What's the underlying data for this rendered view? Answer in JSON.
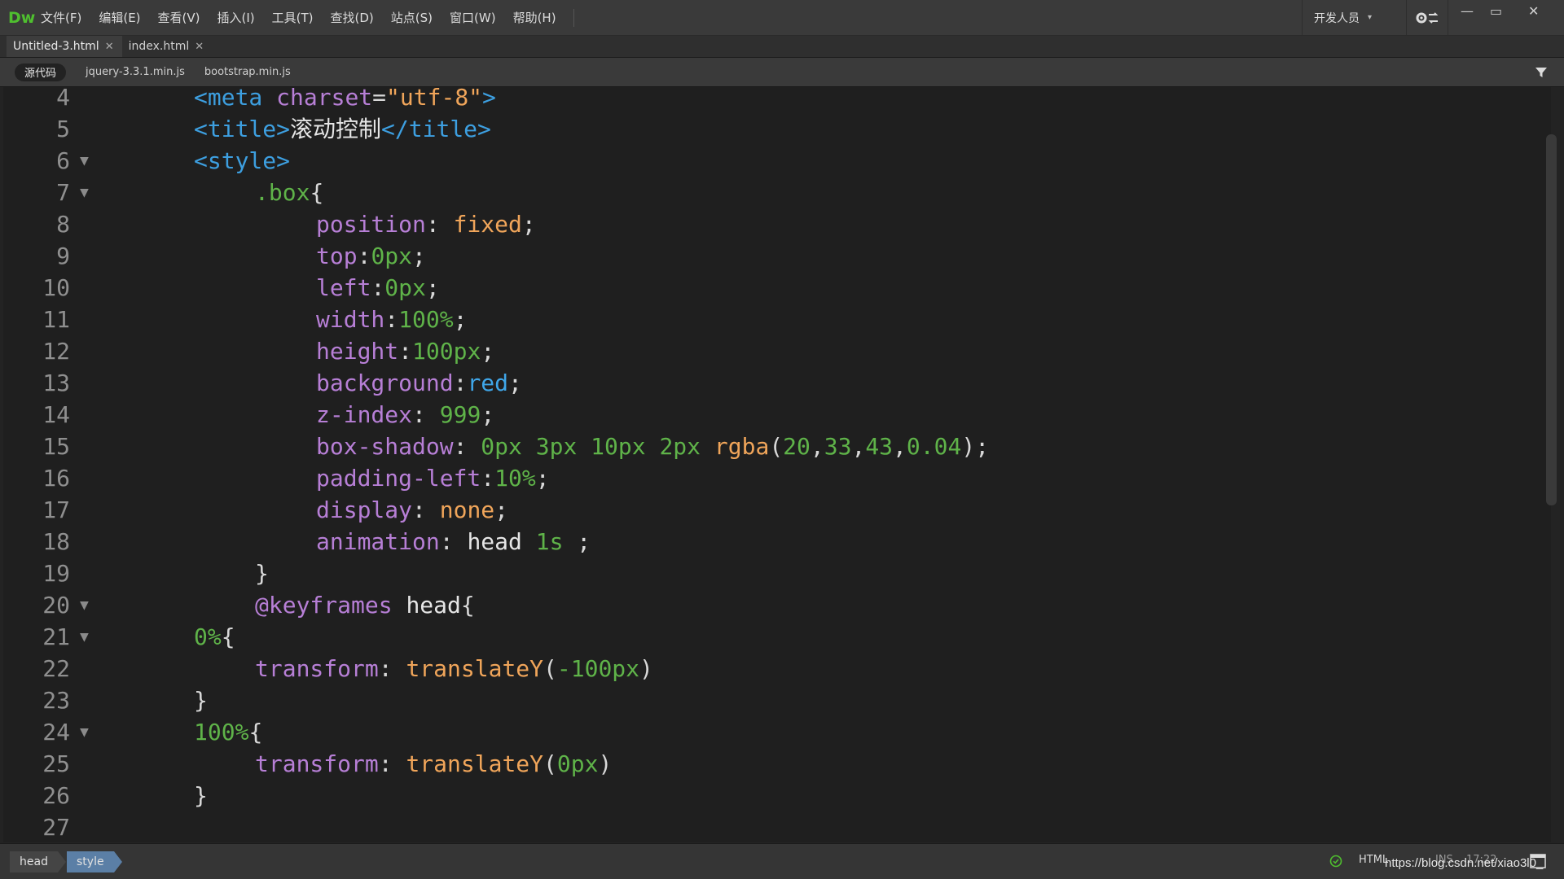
{
  "app": {
    "logo": "Dw"
  },
  "menu": [
    "文件(F)",
    "编辑(E)",
    "查看(V)",
    "插入(I)",
    "工具(T)",
    "查找(D)",
    "站点(S)",
    "窗口(W)",
    "帮助(H)"
  ],
  "workspace": {
    "label": "开发人员"
  },
  "window_controls": {
    "minimize": "—",
    "maximize": "▭",
    "close": "✕"
  },
  "doc_tabs": [
    {
      "label": "Untitled-3.html",
      "active": true
    },
    {
      "label": "index.html",
      "active": false
    }
  ],
  "related_files": {
    "source": "源代码",
    "files": [
      "jquery-3.3.1.min.js",
      "bootstrap.min.js"
    ]
  },
  "code_lines": [
    {
      "n": "4",
      "fold": false,
      "indent": 4,
      "tokens": [
        [
          "tag",
          "<meta "
        ],
        [
          "attr",
          "charset"
        ],
        [
          "pun",
          "="
        ],
        [
          "str",
          "\"utf-8\""
        ],
        [
          "tag",
          ">"
        ]
      ]
    },
    {
      "n": "5",
      "fold": false,
      "indent": 4,
      "tokens": [
        [
          "tag",
          "<title>"
        ],
        [
          "txt",
          "滚动控制"
        ],
        [
          "tag",
          "</title>"
        ]
      ]
    },
    {
      "n": "6",
      "fold": true,
      "indent": 4,
      "tokens": [
        [
          "tag",
          "<style>"
        ]
      ]
    },
    {
      "n": "7",
      "fold": true,
      "indent": 8,
      "tokens": [
        [
          "cls",
          ".box"
        ],
        [
          "pun",
          "{"
        ]
      ]
    },
    {
      "n": "8",
      "fold": false,
      "indent": 12,
      "tokens": [
        [
          "prop",
          "position"
        ],
        [
          "pun",
          ": "
        ],
        [
          "kw",
          "fixed"
        ],
        [
          "pun",
          ";"
        ]
      ]
    },
    {
      "n": "9",
      "fold": false,
      "indent": 12,
      "tokens": [
        [
          "prop",
          "top"
        ],
        [
          "pun",
          ":"
        ],
        [
          "num",
          "0px"
        ],
        [
          "pun",
          ";"
        ]
      ]
    },
    {
      "n": "10",
      "fold": false,
      "indent": 12,
      "tokens": [
        [
          "prop",
          "left"
        ],
        [
          "pun",
          ":"
        ],
        [
          "num",
          "0px"
        ],
        [
          "pun",
          ";"
        ]
      ]
    },
    {
      "n": "11",
      "fold": false,
      "indent": 12,
      "tokens": [
        [
          "prop",
          "width"
        ],
        [
          "pun",
          ":"
        ],
        [
          "num",
          "100%"
        ],
        [
          "pun",
          ";"
        ]
      ]
    },
    {
      "n": "12",
      "fold": false,
      "indent": 12,
      "tokens": [
        [
          "prop",
          "height"
        ],
        [
          "pun",
          ":"
        ],
        [
          "num",
          "100px"
        ],
        [
          "pun",
          ";"
        ]
      ]
    },
    {
      "n": "13",
      "fold": false,
      "indent": 12,
      "tokens": [
        [
          "prop",
          "background"
        ],
        [
          "pun",
          ":"
        ],
        [
          "col",
          "red"
        ],
        [
          "pun",
          ";"
        ]
      ]
    },
    {
      "n": "14",
      "fold": false,
      "indent": 12,
      "tokens": [
        [
          "prop",
          "z-index"
        ],
        [
          "pun",
          ": "
        ],
        [
          "num",
          "999"
        ],
        [
          "pun",
          ";"
        ]
      ]
    },
    {
      "n": "15",
      "fold": false,
      "indent": 12,
      "tokens": [
        [
          "prop",
          "box-shadow"
        ],
        [
          "pun",
          ": "
        ],
        [
          "num",
          "0px 3px 10px 2px "
        ],
        [
          "kw",
          "rgba"
        ],
        [
          "pun",
          "("
        ],
        [
          "num",
          "20"
        ],
        [
          "pun",
          ","
        ],
        [
          "num",
          "33"
        ],
        [
          "pun",
          ","
        ],
        [
          "num",
          "43"
        ],
        [
          "pun",
          ","
        ],
        [
          "num",
          "0.04"
        ],
        [
          "pun",
          ");"
        ]
      ]
    },
    {
      "n": "16",
      "fold": false,
      "indent": 12,
      "tokens": [
        [
          "prop",
          "padding-left"
        ],
        [
          "pun",
          ":"
        ],
        [
          "num",
          "10%"
        ],
        [
          "pun",
          ";"
        ]
      ]
    },
    {
      "n": "17",
      "fold": false,
      "indent": 12,
      "tokens": [
        [
          "prop",
          "display"
        ],
        [
          "pun",
          ": "
        ],
        [
          "kw",
          "none"
        ],
        [
          "pun",
          ";"
        ]
      ]
    },
    {
      "n": "18",
      "fold": false,
      "indent": 12,
      "tokens": [
        [
          "prop",
          "animation"
        ],
        [
          "pun",
          ": "
        ],
        [
          "txt",
          "head "
        ],
        [
          "num",
          "1s"
        ],
        [
          "pun",
          " ;"
        ]
      ]
    },
    {
      "n": "19",
      "fold": false,
      "indent": 8,
      "tokens": [
        [
          "pun",
          "}"
        ]
      ]
    },
    {
      "n": "20",
      "fold": true,
      "indent": 8,
      "tokens": [
        [
          "attr",
          "@keyframes "
        ],
        [
          "txt",
          "head"
        ],
        [
          "pun",
          "{"
        ]
      ]
    },
    {
      "n": "21",
      "fold": true,
      "indent": 4,
      "tokens": [
        [
          "num",
          "0%"
        ],
        [
          "pun",
          "{"
        ]
      ]
    },
    {
      "n": "22",
      "fold": false,
      "indent": 8,
      "tokens": [
        [
          "prop",
          "transform"
        ],
        [
          "pun",
          ": "
        ],
        [
          "kw",
          "translateY"
        ],
        [
          "pun",
          "("
        ],
        [
          "num",
          "-100px"
        ],
        [
          "pun",
          ")"
        ]
      ]
    },
    {
      "n": "23",
      "fold": false,
      "indent": 4,
      "tokens": [
        [
          "pun",
          "}"
        ]
      ]
    },
    {
      "n": "24",
      "fold": true,
      "indent": 4,
      "tokens": [
        [
          "num",
          "100%"
        ],
        [
          "pun",
          "{"
        ]
      ]
    },
    {
      "n": "25",
      "fold": false,
      "indent": 8,
      "tokens": [
        [
          "prop",
          "transform"
        ],
        [
          "pun",
          ": "
        ],
        [
          "kw",
          "translateY"
        ],
        [
          "pun",
          "("
        ],
        [
          "num",
          "0px"
        ],
        [
          "pun",
          ")"
        ]
      ]
    },
    {
      "n": "26",
      "fold": false,
      "indent": 4,
      "tokens": [
        [
          "pun",
          "}"
        ]
      ]
    },
    {
      "n": "27",
      "fold": false,
      "indent": 0,
      "tokens": []
    }
  ],
  "status": {
    "breadcrumbs": [
      "head",
      "style"
    ],
    "doc_type": "HTML",
    "mode": "INS",
    "cursor": "17:22",
    "watermark": "https://blog.csdn.net/xiao3l0_"
  },
  "colors": {
    "tag": "#3d9fe0",
    "attr": "#b77fd6",
    "string": "#f0a55a",
    "number": "#5fb349",
    "logo": "#4fbf2f",
    "breadcrumb_active": "#5b7fa6"
  }
}
